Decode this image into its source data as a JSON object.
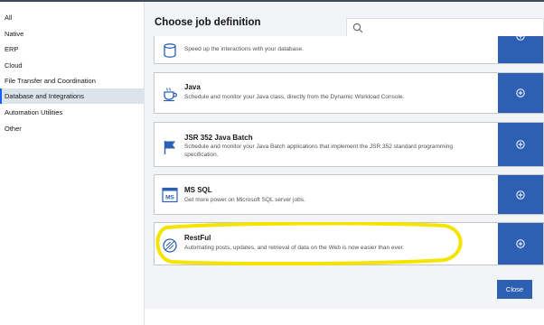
{
  "sidebar": {
    "items": [
      {
        "label": "All"
      },
      {
        "label": "Native"
      },
      {
        "label": "ERP"
      },
      {
        "label": "Cloud"
      },
      {
        "label": "File Transfer and Coordination"
      },
      {
        "label": "Database and Integrations"
      },
      {
        "label": "Automation Utilities"
      },
      {
        "label": "Other"
      }
    ],
    "active_index": 5
  },
  "modal": {
    "title": "Choose job definition",
    "search": {
      "value": "",
      "placeholder": ""
    },
    "close_label": "Close"
  },
  "cards": [
    {
      "title": "",
      "description": "Speed up the interactions with your database.",
      "icon": "database-icon"
    },
    {
      "title": "Java",
      "description": "Schedule and monitor your Java class, directly from the Dynamic Workload Console.",
      "icon": "coffee-cup-icon"
    },
    {
      "title": "JSR 352 Java Batch",
      "description": "Schedule and monitor your Java Batch applications that implement the JSR 352 standard programming specification.",
      "icon": "flag-icon"
    },
    {
      "title": "MS SQL",
      "description": "Get more power on Microsoft SQL server jobs.",
      "icon": "ms-sql-icon"
    },
    {
      "title": "RestFul",
      "description": "Automating posts, updates, and retrieval of data on the Web is now easier than ever.",
      "icon": "restful-icon"
    }
  ],
  "colors": {
    "accent": "#2d5fb3",
    "highlight": "#f4e400",
    "sidebar_active": "#dde3ea",
    "panel_bg": "#f2f4f8"
  }
}
